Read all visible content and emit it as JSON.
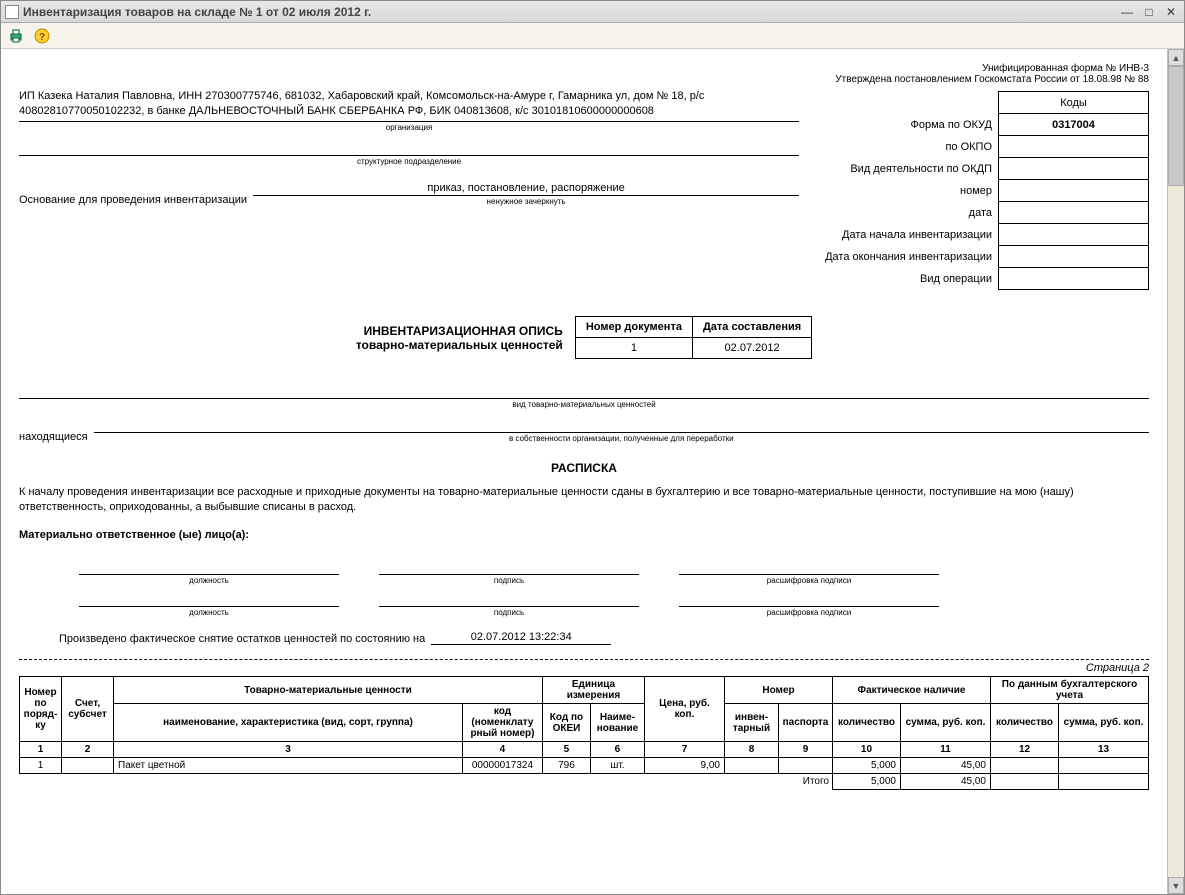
{
  "window": {
    "title": "Инвентаризация товаров на складе № 1 от 02 июля 2012 г."
  },
  "header": {
    "form_line": "Унифицированная форма № ИНВ-3",
    "approved_line": "Утверждена постановлением Госкомстата России от 18.08.98 № 88"
  },
  "codes": {
    "header": "Коды",
    "okud_label": "Форма по ОКУД",
    "okud_val": "0317004",
    "okpo_label": "по ОКПО",
    "okpo_val": "",
    "okdp_label": "Вид деятельности по ОКДП",
    "okdp_val": "",
    "number_label": "номер",
    "number_val": "",
    "date_label": "дата",
    "date_val": "",
    "inv_start_label": "Дата начала инвентаризации",
    "inv_start_val": "",
    "inv_end_label": "Дата окончания инвентаризации",
    "inv_end_val": "",
    "oper_label": "Вид операции",
    "oper_val": ""
  },
  "org": {
    "text": "ИП Казека Наталия Павловна, ИНН 270300775746, 681032, Хабаровский край, Комсомольск-на-Амуре г, Гамарника ул, дом № 18, р/с 40802810770050102232, в банке ДАЛЬНЕВОСТОЧНЫЙ БАНК СБЕРБАНКА РФ, БИК 040813608, к/с 30101810600000000608",
    "caption_org": "организация",
    "caption_unit": "структурное подразделение"
  },
  "basis": {
    "label": "Основание для проведения инвентаризации",
    "value": "приказ, постановление, распоряжение",
    "caption": "ненужное зачеркнуть"
  },
  "doc_meta": {
    "col_num": "Номер документа",
    "col_date": "Дата составления",
    "num": "1",
    "date": "02.07.2012",
    "title1": "ИНВЕНТАРИЗАЦИОННАЯ ОПИСЬ",
    "title2": "товарно-материальных ценностей"
  },
  "kind_caption": "вид товарно-материальных ценностей",
  "located_label": "находящиеся",
  "located_caption": "в собственности организации, полученные для переработки",
  "receipt_title": "РАСПИСКА",
  "receipt_text": "К началу проведения инвентаризации все расходные и приходные документы на товарно-материальные ценности сданы в бухгалтерию и все товарно-материальные ценности, поступившие на мою (нашу) ответственность, оприходованны, а выбывшие списаны в расход.",
  "responsible_label": "Материально ответственное (ые) лицо(а):",
  "sig": {
    "position": "должность",
    "sign": "подпись",
    "decode": "расшифровка подписи"
  },
  "snapshot": {
    "label": "Произведено фактическое снятие остатков ценностей по состоянию на",
    "value": "02.07.2012 13:22:34"
  },
  "page_marker": "Страница 2",
  "table": {
    "h_num": "Номер по поряд-ку",
    "h_acc": "Счет, субсчет",
    "h_goods": "Товарно-материальные ценности",
    "h_goods_name": "наименование, характеристика (вид, сорт, группа)",
    "h_goods_code": "код (номенклату рный номер)",
    "h_unit": "Единица измерения",
    "h_unit_code": "Код по ОКЕИ",
    "h_unit_name": "Наиме-нование",
    "h_price": "Цена, руб. коп.",
    "h_number": "Номер",
    "h_inv": "инвен-тарный",
    "h_pass": "паспорта",
    "h_fact": "Фактическое наличие",
    "h_book": "По данным бухгалтерского учета",
    "h_qty": "количество",
    "h_sum": "сумма, руб. коп.",
    "cols": [
      "1",
      "2",
      "3",
      "4",
      "5",
      "6",
      "7",
      "8",
      "9",
      "10",
      "11",
      "12",
      "13"
    ],
    "rows": [
      {
        "n": "1",
        "acc": "",
        "name": "Пакет цветной",
        "code": "00000017324",
        "okei": "796",
        "unit": "шт.",
        "price": "9,00",
        "inv": "",
        "pass": "",
        "fact_qty": "5,000",
        "fact_sum": "45,00",
        "book_qty": "",
        "book_sum": ""
      }
    ],
    "total_label": "Итого",
    "total_fact_qty": "5,000",
    "total_fact_sum": "45,00"
  }
}
